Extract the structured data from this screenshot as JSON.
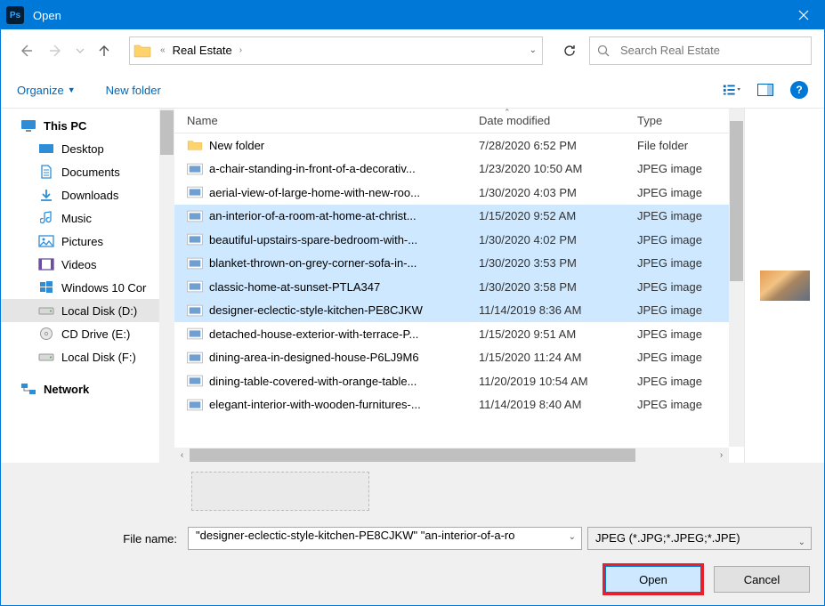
{
  "window": {
    "title": "Open"
  },
  "breadcrumb": {
    "current": "Real Estate"
  },
  "search": {
    "placeholder": "Search Real Estate"
  },
  "toolbar": {
    "organize": "Organize",
    "new_folder": "New folder"
  },
  "columns": {
    "name": "Name",
    "date": "Date modified",
    "type": "Type"
  },
  "tree": {
    "this_pc": "This PC",
    "items": [
      {
        "label": "Desktop"
      },
      {
        "label": "Documents"
      },
      {
        "label": "Downloads"
      },
      {
        "label": "Music"
      },
      {
        "label": "Pictures"
      },
      {
        "label": "Videos"
      },
      {
        "label": "Windows 10 Cor"
      },
      {
        "label": "Local Disk (D:)"
      },
      {
        "label": "CD Drive (E:)"
      },
      {
        "label": "Local Disk (F:)"
      }
    ],
    "network": "Network"
  },
  "files": [
    {
      "name": "New folder",
      "date": "7/28/2020 6:52 PM",
      "type": "File folder",
      "kind": "folder",
      "selected": false
    },
    {
      "name": "a-chair-standing-in-front-of-a-decorativ...",
      "date": "1/23/2020 10:50 AM",
      "type": "JPEG image",
      "kind": "jpg",
      "selected": false
    },
    {
      "name": "aerial-view-of-large-home-with-new-roo...",
      "date": "1/30/2020 4:03 PM",
      "type": "JPEG image",
      "kind": "jpg",
      "selected": false
    },
    {
      "name": "an-interior-of-a-room-at-home-at-christ...",
      "date": "1/15/2020 9:52 AM",
      "type": "JPEG image",
      "kind": "jpg",
      "selected": true
    },
    {
      "name": "beautiful-upstairs-spare-bedroom-with-...",
      "date": "1/30/2020 4:02 PM",
      "type": "JPEG image",
      "kind": "jpg",
      "selected": true
    },
    {
      "name": "blanket-thrown-on-grey-corner-sofa-in-...",
      "date": "1/30/2020 3:53 PM",
      "type": "JPEG image",
      "kind": "jpg",
      "selected": true
    },
    {
      "name": "classic-home-at-sunset-PTLA347",
      "date": "1/30/2020 3:58 PM",
      "type": "JPEG image",
      "kind": "jpg",
      "selected": true
    },
    {
      "name": "designer-eclectic-style-kitchen-PE8CJKW",
      "date": "11/14/2019 8:36 AM",
      "type": "JPEG image",
      "kind": "jpg",
      "selected": true
    },
    {
      "name": "detached-house-exterior-with-terrace-P...",
      "date": "1/15/2020 9:51 AM",
      "type": "JPEG image",
      "kind": "jpg",
      "selected": false
    },
    {
      "name": "dining-area-in-designed-house-P6LJ9M6",
      "date": "1/15/2020 11:24 AM",
      "type": "JPEG image",
      "kind": "jpg",
      "selected": false
    },
    {
      "name": "dining-table-covered-with-orange-table...",
      "date": "11/20/2019 10:54 AM",
      "type": "JPEG image",
      "kind": "jpg",
      "selected": false
    },
    {
      "name": "elegant-interior-with-wooden-furnitures-...",
      "date": "11/14/2019 8:40 AM",
      "type": "JPEG image",
      "kind": "jpg",
      "selected": false
    }
  ],
  "file_name": {
    "label": "File name:",
    "value": "\"designer-eclectic-style-kitchen-PE8CJKW\" \"an-interior-of-a-ro"
  },
  "filter": {
    "value": "JPEG (*.JPG;*.JPEG;*.JPE)"
  },
  "buttons": {
    "open": "Open",
    "cancel": "Cancel"
  }
}
